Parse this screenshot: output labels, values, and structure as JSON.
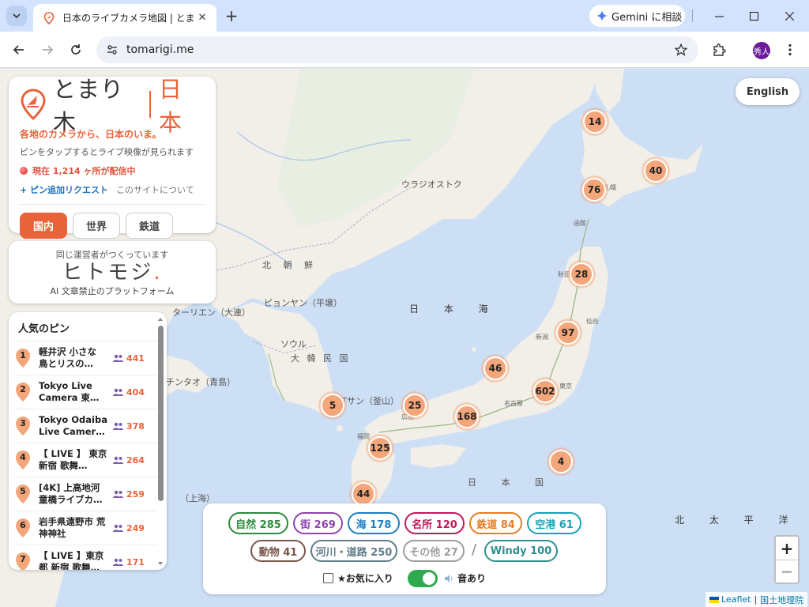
{
  "browser": {
    "tab_title": "日本のライブカメラ地図 | とまり木",
    "gemini_label": "Gemini に相談",
    "url": "tomarigi.me",
    "avatar_text": "秀人"
  },
  "brand": {
    "name": "とまり木",
    "country": "日本",
    "tagline": "各地のカメラから、日本のいま。",
    "subtagline": "ピンをタップするとライブ映像が見られます",
    "live_status": "現在 1,214 ヶ所が配信中",
    "add_pin_link": "+ ピン追加リクエスト",
    "about_link": "このサイトについて",
    "modes": [
      "国内",
      "世界",
      "鉄道"
    ],
    "active_mode": "国内",
    "accent_color": "#e8633a"
  },
  "ad": {
    "top": "同じ運営者がつくっています",
    "logo": "ヒトモジ",
    "logo_dot": ".",
    "bottom": "AI 文章禁止のプラットフォーム"
  },
  "popular": {
    "title": "人気のピン",
    "items": [
      {
        "rank": "1",
        "name": "軽井沢 小さな 鳥とリスの…",
        "viewers": "441"
      },
      {
        "rank": "2",
        "name": "Tokyo Live Camera 東…",
        "viewers": "404"
      },
      {
        "rank": "3",
        "name": "Tokyo Odaiba Live Camer…",
        "viewers": "378"
      },
      {
        "rank": "4",
        "name": "【 LIVE 】 東京 新宿 歌舞…",
        "viewers": "264"
      },
      {
        "rank": "5",
        "name": "[4K] 上高地河 童橋ライブカ…",
        "viewers": "259"
      },
      {
        "rank": "6",
        "name": "岩手県遠野市 荒神神社",
        "viewers": "249"
      },
      {
        "rank": "7",
        "name": "【 LIVE 】東京 都 新宿 歌舞…",
        "viewers": "171"
      }
    ]
  },
  "filters": {
    "chips_row1": [
      {
        "label": "自然 285",
        "color": "#2e8b3e"
      },
      {
        "label": "街 269",
        "color": "#8e44ad"
      },
      {
        "label": "海 178",
        "color": "#1e7fc1"
      },
      {
        "label": "名所 120",
        "color": "#c2185b"
      },
      {
        "label": "鉄道 84",
        "color": "#e67e22"
      },
      {
        "label": "空港 61",
        "color": "#17a2b8"
      }
    ],
    "chips_row2": [
      {
        "label": "動物 41",
        "color": "#795548"
      },
      {
        "label": "河川・道路 250",
        "color": "#607d8b"
      },
      {
        "label": "その他 27",
        "color": "#9e9e9e"
      },
      {
        "label": "Windy 100",
        "color": "#2f8f8f"
      }
    ],
    "separator": "/",
    "favorites_label": "★お気に入り",
    "sound_label": "音あり",
    "sound_on": true
  },
  "map": {
    "language_button": "English",
    "zoom_in": "+",
    "zoom_out": "−",
    "attribution_leaflet": "Leaflet",
    "attribution_sep": "|",
    "attribution_gsi": "国土地理院",
    "clusters": [
      "14",
      "40",
      "76",
      "28",
      "97",
      "46",
      "602",
      "5",
      "25",
      "168",
      "125",
      "4",
      "44"
    ],
    "labels": {
      "vladivostok": "ウラジオストク",
      "north_korea": "北 朝 鮮",
      "pyongyang": "ピョンヤン（平壌）",
      "seoul": "ソウル",
      "south_korea": "大 韓 民 国",
      "busan": "プサン（釜山）",
      "taiyuan": "ターリエン（大連）",
      "qingdao": "チンタオ（青島）",
      "shanghai": "（上海）",
      "sea_of_japan": "日 本 海",
      "japan": "日 本 国",
      "pacific": "北 太 平 洋",
      "sendai": "仙台",
      "tokyo": "東京",
      "nagoya": "名古屋",
      "niigata": "新潟",
      "sapporo": "札幌",
      "hakodate": "函館",
      "akita": "秋田",
      "hiroshima": "広島",
      "fukuoka": "福岡"
    }
  }
}
